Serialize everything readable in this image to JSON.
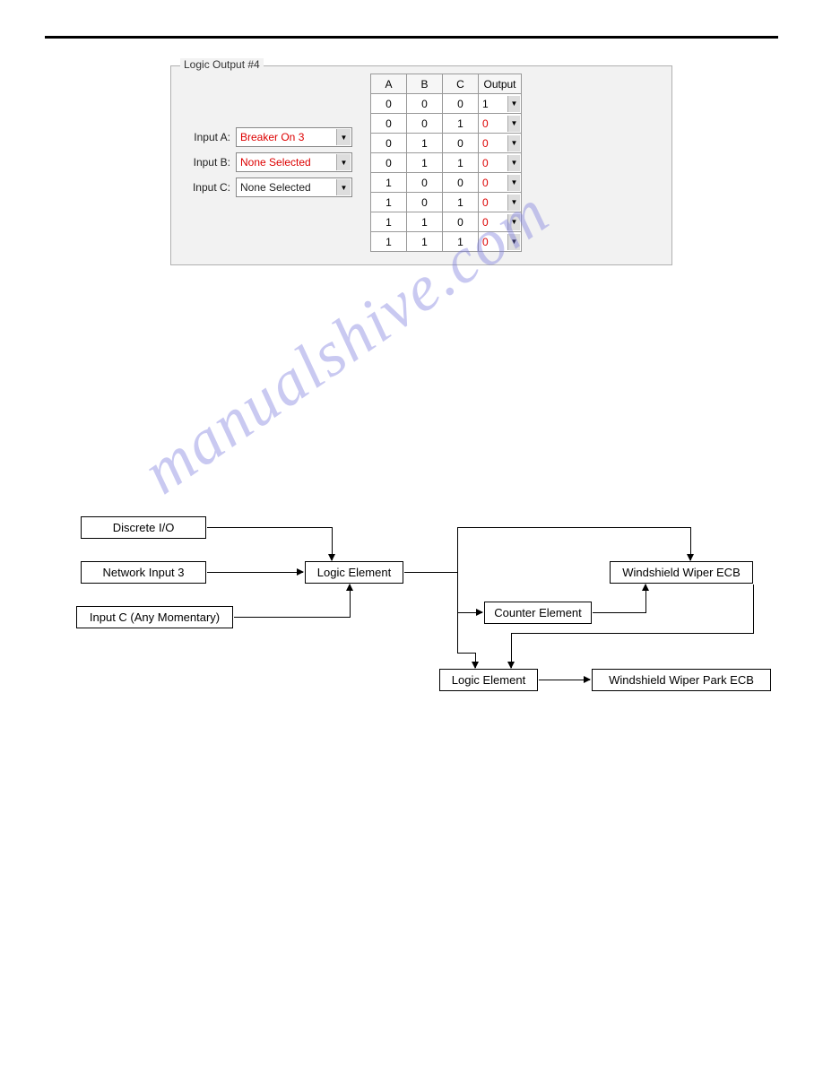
{
  "panel": {
    "title": "Logic Output #4",
    "inputs": [
      {
        "label": "Input A:",
        "value": "Breaker On 3",
        "red": true
      },
      {
        "label": "Input B:",
        "value": "None Selected",
        "red": true
      },
      {
        "label": "Input C:",
        "value": "None Selected",
        "red": false
      }
    ],
    "table": {
      "headers": [
        "A",
        "B",
        "C",
        "Output"
      ],
      "rows": [
        {
          "a": "0",
          "b": "0",
          "c": "0",
          "out": "1",
          "out_red": false
        },
        {
          "a": "0",
          "b": "0",
          "c": "1",
          "out": "0",
          "out_red": true
        },
        {
          "a": "0",
          "b": "1",
          "c": "0",
          "out": "0",
          "out_red": true
        },
        {
          "a": "0",
          "b": "1",
          "c": "1",
          "out": "0",
          "out_red": true
        },
        {
          "a": "1",
          "b": "0",
          "c": "0",
          "out": "0",
          "out_red": true
        },
        {
          "a": "1",
          "b": "0",
          "c": "1",
          "out": "0",
          "out_red": true
        },
        {
          "a": "1",
          "b": "1",
          "c": "0",
          "out": "0",
          "out_red": true
        },
        {
          "a": "1",
          "b": "1",
          "c": "1",
          "out": "0",
          "out_red": true
        }
      ]
    }
  },
  "watermark": "manualshive.com",
  "diagram": {
    "boxes": {
      "discrete_io": "Discrete I/O",
      "network_input_3": "Network Input 3",
      "input_c_momentary": "Input C (Any Momentary)",
      "logic_element_1": "Logic Element",
      "counter_element": "Counter Element",
      "windshield_wiper_ecb": "Windshield Wiper ECB",
      "logic_element_2": "Logic Element",
      "windshield_wiper_park_ecb": "Windshield Wiper Park ECB"
    }
  },
  "chart_data": {
    "type": "table",
    "title": "Logic Output #4",
    "columns": [
      "A",
      "B",
      "C",
      "Output"
    ],
    "rows": [
      [
        0,
        0,
        0,
        1
      ],
      [
        0,
        0,
        1,
        0
      ],
      [
        0,
        1,
        0,
        0
      ],
      [
        0,
        1,
        1,
        0
      ],
      [
        1,
        0,
        0,
        0
      ],
      [
        1,
        0,
        1,
        0
      ],
      [
        1,
        1,
        0,
        0
      ],
      [
        1,
        1,
        1,
        0
      ]
    ]
  }
}
